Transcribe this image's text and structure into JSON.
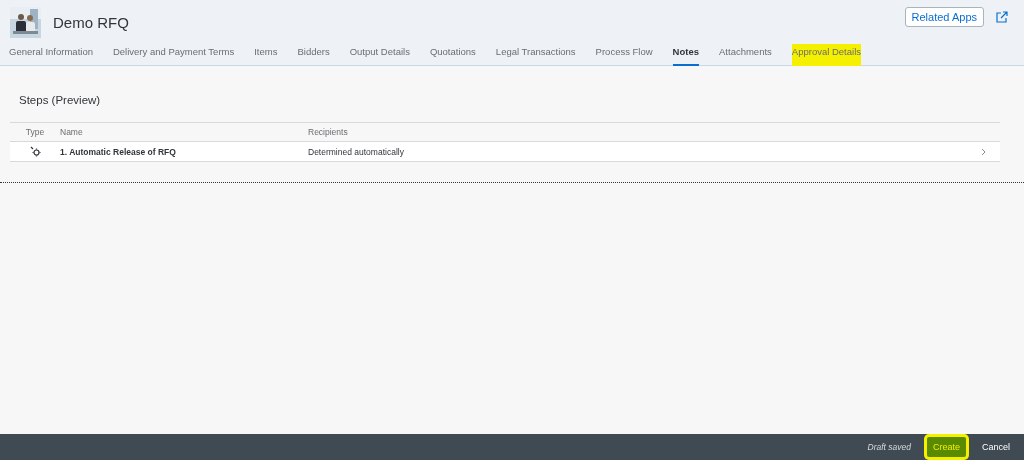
{
  "header": {
    "title": "Demo RFQ",
    "related_apps": "Related Apps"
  },
  "tabs": [
    {
      "label": "General Information",
      "selected": false,
      "highlighted": false
    },
    {
      "label": "Delivery and Payment Terms",
      "selected": false,
      "highlighted": false
    },
    {
      "label": "Items",
      "selected": false,
      "highlighted": false
    },
    {
      "label": "Bidders",
      "selected": false,
      "highlighted": false
    },
    {
      "label": "Output Details",
      "selected": false,
      "highlighted": false
    },
    {
      "label": "Quotations",
      "selected": false,
      "highlighted": false
    },
    {
      "label": "Legal Transactions",
      "selected": false,
      "highlighted": false
    },
    {
      "label": "Process Flow",
      "selected": false,
      "highlighted": false
    },
    {
      "label": "Notes",
      "selected": true,
      "highlighted": false
    },
    {
      "label": "Attachments",
      "selected": false,
      "highlighted": false
    },
    {
      "label": "Approval Details",
      "selected": false,
      "highlighted": true
    }
  ],
  "section": {
    "title": "Steps (Preview)",
    "columns": [
      "Type",
      "Name",
      "Recipients"
    ],
    "rows": [
      {
        "name": "1. Automatic Release of RFQ",
        "recipients": "Determined automatically"
      }
    ]
  },
  "footer": {
    "status": "Draft saved",
    "buttons": [
      {
        "label": "Create",
        "kind": "primary",
        "highlighted": true
      },
      {
        "label": "Cancel",
        "kind": "plain",
        "highlighted": false
      }
    ]
  }
}
